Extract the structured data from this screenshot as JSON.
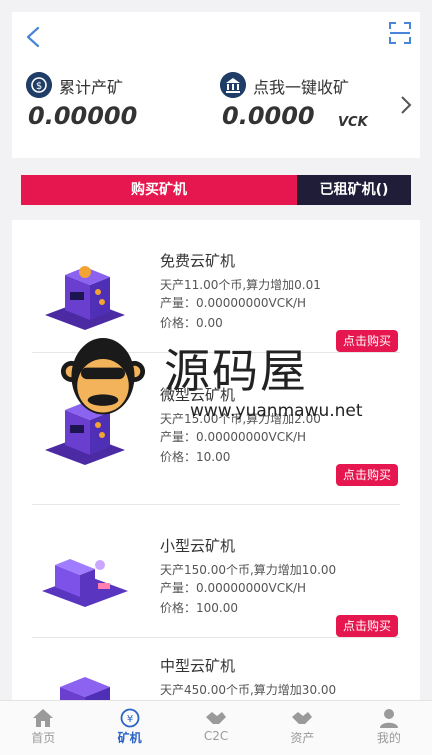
{
  "header": {
    "stat_total_label": "累计产矿",
    "stat_total_value": "0.00000",
    "stat_collect_label": "点我一键收矿",
    "stat_collect_value": "0.0000",
    "unit": "VCK"
  },
  "tabs": {
    "buy_label": "购买矿机",
    "rented_label": "已租矿机()"
  },
  "miners": [
    {
      "name": "免费云矿机",
      "output": "天产11.00个币,算力增加0.01",
      "yield": "产量：0.00000000VCK/H",
      "price": "价格：0.00",
      "buy_label": "点击购买"
    },
    {
      "name": "微型云矿机",
      "output": "天产15.00个币,算力增加2.00",
      "yield": "产量：0.00000000VCK/H",
      "price": "价格：10.00",
      "buy_label": "点击购买"
    },
    {
      "name": "小型云矿机",
      "output": "天产150.00个币,算力增加10.00",
      "yield": "产量：0.00000000VCK/H",
      "price": "价格：100.00",
      "buy_label": "点击购买"
    },
    {
      "name": "中型云矿机",
      "output": "天产450.00个币,算力增加30.00",
      "yield": "",
      "price": "",
      "buy_label": ""
    }
  ],
  "watermark": {
    "text": "源码屋",
    "url": "www.yuanmawu.net"
  },
  "tabbar": [
    {
      "label": "首页",
      "icon": "home-icon"
    },
    {
      "label": "矿机",
      "icon": "miner-icon"
    },
    {
      "label": "C2C",
      "icon": "handshake-icon"
    },
    {
      "label": "资产",
      "icon": "wallet-icon"
    },
    {
      "label": "我的",
      "icon": "user-icon"
    }
  ],
  "colors": {
    "accent_red": "#e5174e",
    "dark_navy": "#1f1d38",
    "active_blue": "#2a63c6"
  }
}
